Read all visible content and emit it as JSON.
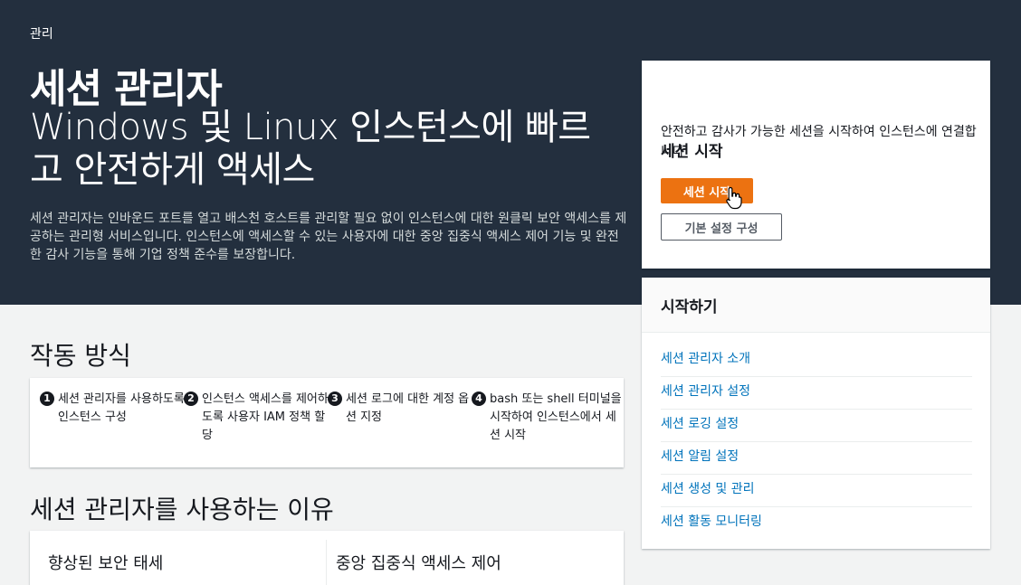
{
  "breadcrumb": "관리",
  "hero": {
    "title": "세션 관리자",
    "subtitle": "Windows 및 Linux 인스턴스에 빠르고 안전하게 액세스",
    "description": "세션 관리자는 인바운드 포트를 열고 배스천 호스트를 관리할 필요 없이 인스턴스에 대한 원클릭 보안 액세스를 제공하는 관리형 서비스입니다. 인스턴스에 액세스할 수 있는 사용자에 대한 중앙 집중식 액세스 제어 기능 및 완전한 감사 기능을 통해 기업 정책 준수를 보장합니다."
  },
  "start_panel": {
    "title": "세션 시작",
    "description": "안전하고 감사가 가능한 세션을 시작하여 인스턴스에 연결합니다",
    "primary_button": "세션 시작",
    "secondary_button": "기본 설정 구성"
  },
  "getting_started": {
    "title": "시작하기",
    "links": [
      "세션 관리자 소개",
      "세션 관리자 설정",
      "세션 로깅 설정",
      "세션 알림 설정",
      "세션 생성 및 관리",
      "세션 활동 모니터링"
    ]
  },
  "how_it_works": {
    "title": "작동 방식",
    "steps": [
      {
        "num": "1",
        "text": "세션 관리자를 사용하도록 인스턴스 구성"
      },
      {
        "num": "2",
        "text": "인스턴스 액세스를 제어하도록 사용자 IAM 정책 할당"
      },
      {
        "num": "3",
        "text": "세션 로그에 대한 계정 옵션 지정"
      },
      {
        "num": "4",
        "text": "bash 또는 shell 터미널을 시작하여 인스턴스에서 세션 시작"
      }
    ]
  },
  "why": {
    "title": "세션 관리자를 사용하는 이유",
    "columns": [
      "향상된 보안 태세",
      "중앙 집중식 액세스 제어"
    ]
  },
  "colors": {
    "header_bg": "#232f3e",
    "primary": "#ec7211",
    "link": "#0073bb"
  }
}
